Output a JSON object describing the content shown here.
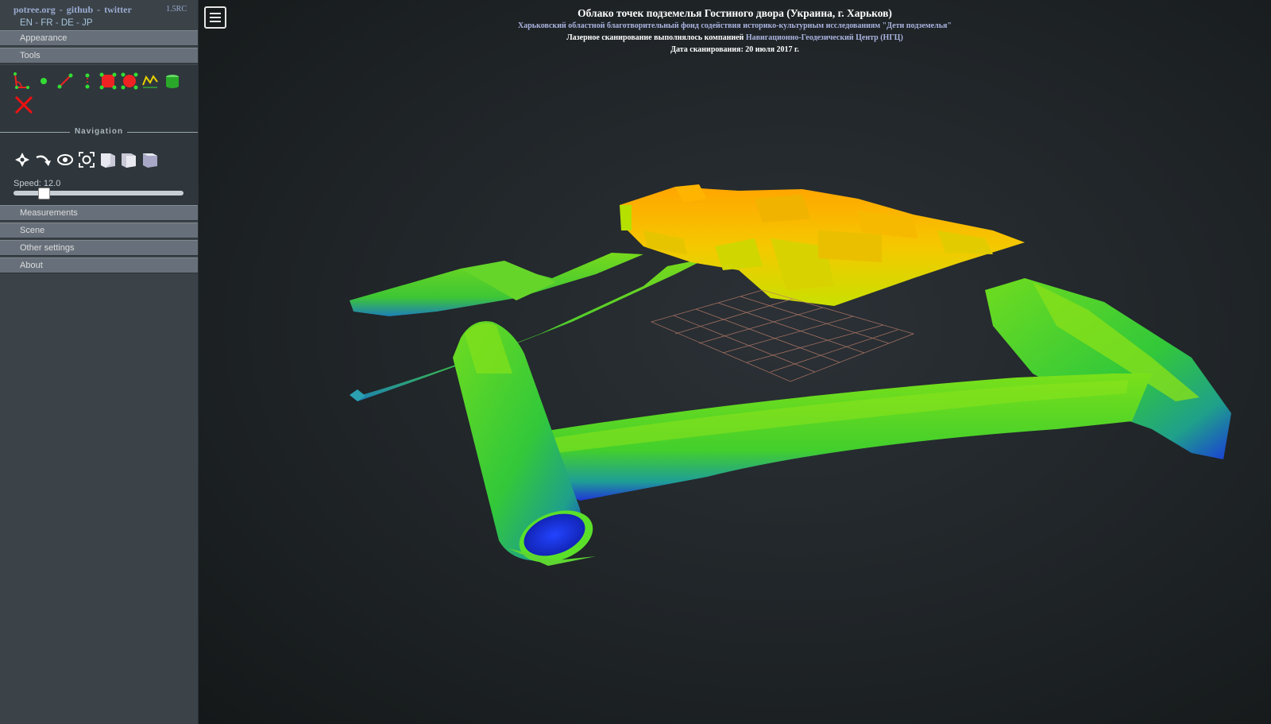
{
  "header": {
    "links": [
      "potree.org",
      "github",
      "twitter"
    ],
    "separator": "-",
    "version": "1.5RC",
    "languages": [
      "EN",
      "FR",
      "DE",
      "JP"
    ],
    "lang_separator": "-"
  },
  "sidebar": {
    "sections": {
      "appearance": "Appearance",
      "tools": "Tools",
      "navigation": "Navigation",
      "measurements": "Measurements",
      "scene": "Scene",
      "other": "Other settings",
      "about": "About"
    },
    "speed_label": "Speed: 12.0",
    "speed_value": 12.0,
    "tool_icons": [
      "angle-measure-icon",
      "point-measure-icon",
      "distance-measure-icon",
      "height-measure-icon",
      "area-measure-icon",
      "volume-measure-icon",
      "profile-icon",
      "clip-volume-icon",
      "remove-all-icon"
    ],
    "nav_icons": [
      "fly-control-icon",
      "orbit-control-icon",
      "earth-control-icon",
      "focus-icon",
      "front-view-icon",
      "left-view-icon",
      "top-view-icon"
    ]
  },
  "viewer": {
    "title": "Облако точек подземелья Гостиного двора (Украина, г. Харьков)",
    "subtitle": "Харьковский областной благотворительный фонд содействия историко-культурным исследованиям \"Дети подземелья\"",
    "scan_text": "Лазерное сканирование выполнялось компанией",
    "scan_company": "Навигационно-Геодезический Центр (НГЦ)",
    "date_text": "Дата сканирования: 20 июля 2017 г."
  },
  "colors": {
    "sidebar_bg": "#3b4349",
    "accordion_bg": "#67707a",
    "link_color": "#9aa9cf",
    "viewer_bg": "#1f2427",
    "cloud_low": "#1b2fe0",
    "cloud_mid": "#59d620",
    "cloud_high": "#f5a800"
  }
}
